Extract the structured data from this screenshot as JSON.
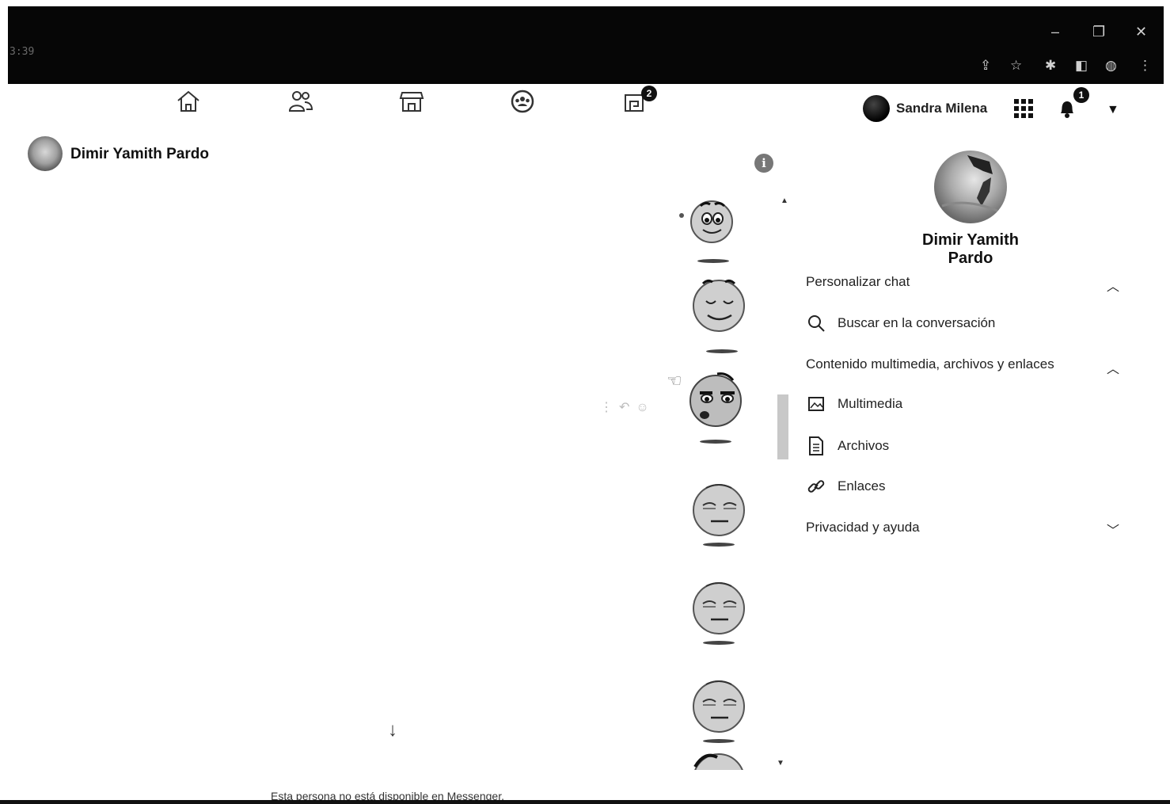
{
  "browser": {
    "tab_time": "3:39",
    "controls": {
      "minimize": "–",
      "restore": "❐",
      "close": "✕"
    },
    "toolbar_icons": [
      "share-icon",
      "star-icon",
      "extensions-icon",
      "sidebar-icon",
      "profile-icon",
      "menu-icon"
    ]
  },
  "nav": {
    "items": [
      "home-icon",
      "friends-icon",
      "marketplace-icon",
      "groups-icon",
      "gaming-icon"
    ],
    "gaming_badge": "2",
    "user_name": "Sandra Milena",
    "notifications_badge": "1"
  },
  "chat": {
    "contact_name": "Dimir Yamith Pardo",
    "unavailable_text": "Esta persona no está disponible en Messenger."
  },
  "panel": {
    "contact_name": "Dimir Yamith Pardo",
    "sections": {
      "customize": "Personalizar chat",
      "search": "Buscar en la conversación",
      "media_section": "Contenido multimedia, archivos y enlaces",
      "media": "Multimedia",
      "files": "Archivos",
      "links": "Enlaces",
      "privacy": "Privacidad y ayuda"
    }
  }
}
